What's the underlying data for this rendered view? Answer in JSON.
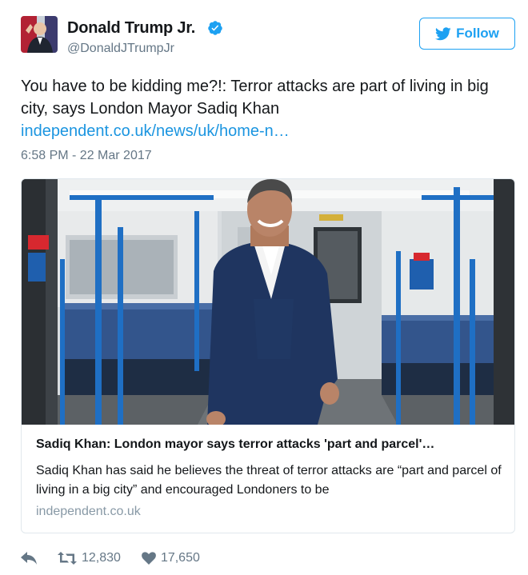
{
  "user": {
    "name": "Donald Trump Jr.",
    "handle": "@DonaldJTrumpJr",
    "verified": true
  },
  "follow_button": {
    "label": "Follow"
  },
  "tweet": {
    "text": "You have to be kidding me?!: Terror attacks are part of living in big city, says London Mayor Sadiq Khan ",
    "link_text": "independent.co.uk/news/uk/home-n…",
    "timestamp": "6:58 PM - 22 Mar 2017"
  },
  "card": {
    "title": "Sadiq Khan: London mayor says terror attacks 'part and parcel'…",
    "description": "Sadiq Khan has said he believes the threat of terror attacks are “part and parcel of living in a big city” and encouraged Londoners to be",
    "domain": "independent.co.uk"
  },
  "actions": {
    "reply_icon": "reply-icon",
    "retweet_icon": "retweet-icon",
    "like_icon": "heart-icon",
    "retweets": "12,830",
    "likes": "17,650"
  },
  "colors": {
    "accent": "#1da1f2",
    "link": "#1b95e0",
    "muted": "#657786"
  }
}
